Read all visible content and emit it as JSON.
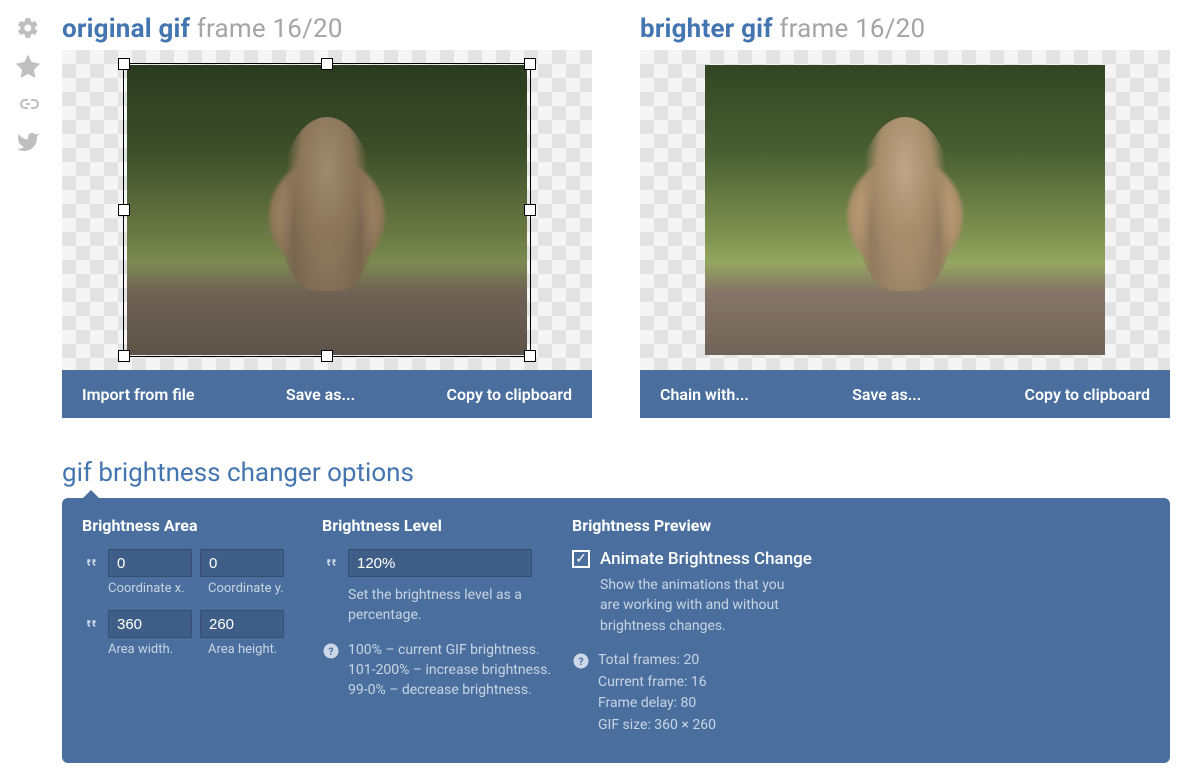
{
  "sidebar_icons": [
    "gear-icon",
    "star-icon",
    "link-icon",
    "twitter-icon"
  ],
  "left": {
    "title_bold": "original gif",
    "title_thin": "frame 16/20",
    "actions": {
      "import": "Import from file",
      "save": "Save as...",
      "copy": "Copy to clipboard"
    }
  },
  "right": {
    "title_bold": "brighter gif",
    "title_thin": "frame 16/20",
    "actions": {
      "chain": "Chain with...",
      "save": "Save as...",
      "copy": "Copy to clipboard"
    }
  },
  "options_title": "gif brightness changer options",
  "area": {
    "heading": "Brightness Area",
    "x": "0",
    "y": "0",
    "x_label": "Coordinate x.",
    "y_label": "Coordinate y.",
    "w": "360",
    "h": "260",
    "w_label": "Area width.",
    "h_label": "Area height."
  },
  "level": {
    "heading": "Brightness Level",
    "value": "120%",
    "desc": "Set the brightness level as a percentage.",
    "help": "100% – current GIF brightness.\n101-200% – increase brightness.\n99-0% – decrease brightness."
  },
  "preview": {
    "heading": "Brightness Preview",
    "checkbox_label": "Animate Brightness Change",
    "checkbox_checked": true,
    "desc": "Show the animations that you are are working with and without brightness changes.",
    "desc_line1": "Show the animations that you",
    "desc_line2": "are working with and without",
    "desc_line3": "brightness changes.",
    "info": {
      "total_frames": "Total frames: 20",
      "current_frame": "Current frame: 16",
      "frame_delay": "Frame delay: 80",
      "gif_size": "GIF size: 360 × 260"
    }
  }
}
